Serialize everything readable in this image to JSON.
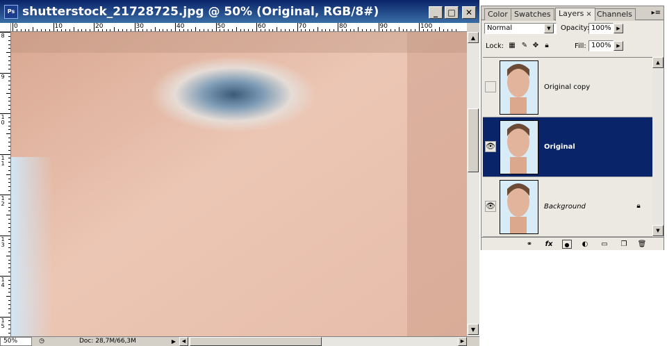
{
  "document": {
    "title": "shutterstock_21728725.jpg @ 50% (Original, RGB/8#)",
    "app_icon_label": "Ps",
    "window_controls": {
      "minimize": "_",
      "maximize": "□",
      "close": "✕"
    },
    "rulers": {
      "horizontal_labels": [
        "0",
        "10",
        "20",
        "30",
        "40",
        "50",
        "60",
        "70",
        "80",
        "90",
        "100"
      ],
      "vertical_labels": [
        "8",
        "9",
        "10",
        "11",
        "12",
        "13",
        "14",
        "15"
      ]
    },
    "status": {
      "zoom": "50%",
      "doc_size": "Doc: 28,7M/66,3M"
    }
  },
  "panel": {
    "tabs": [
      {
        "label": "Color",
        "active": false
      },
      {
        "label": "Swatches",
        "active": false
      },
      {
        "label": "Layers",
        "active": true,
        "close": "×"
      },
      {
        "label": "Channels",
        "active": false
      }
    ],
    "menu_glyph": "▸≡",
    "blend_mode": "Normal",
    "opacity_label": "Opacity:",
    "opacity_value": "100%",
    "lock_label": "Lock:",
    "fill_label": "Fill:",
    "fill_value": "100%",
    "layers": [
      {
        "name": "Original copy",
        "visible": false,
        "selected": false,
        "locked": false
      },
      {
        "name": "Original",
        "visible": true,
        "selected": true,
        "locked": false
      },
      {
        "name": "Background",
        "visible": true,
        "selected": false,
        "locked": true
      }
    ],
    "footer_icons": [
      "link-layers-icon",
      "layer-style-icon",
      "layer-mask-icon",
      "adjustment-layer-icon",
      "new-group-icon",
      "new-layer-icon",
      "delete-layer-icon"
    ]
  },
  "colors": {
    "title_bar": "#0a246a",
    "selected_layer": "#0a246a",
    "chrome": "#d4d0c8"
  }
}
